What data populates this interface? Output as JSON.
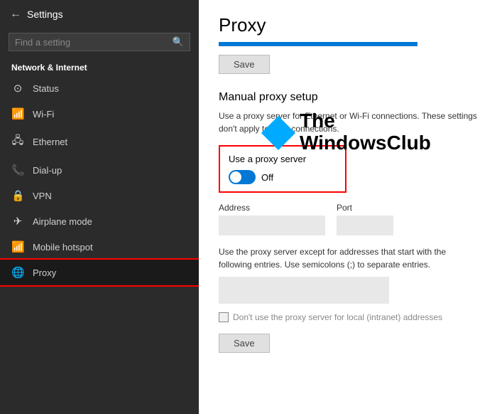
{
  "window": {
    "title": "Settings"
  },
  "sidebar": {
    "back_label": "←",
    "title": "Settings",
    "search_placeholder": "Find a setting",
    "section_label": "Network & Internet",
    "nav_items": [
      {
        "id": "status",
        "icon": "⊙",
        "label": "Status"
      },
      {
        "id": "wifi",
        "icon": "((•))",
        "label": "Wi-Fi"
      },
      {
        "id": "ethernet",
        "icon": "⬛",
        "label": "Ethernet"
      },
      {
        "id": "dialup",
        "icon": "📞",
        "label": "Dial-up"
      },
      {
        "id": "vpn",
        "icon": "🔒",
        "label": "VPN"
      },
      {
        "id": "airplane",
        "icon": "✈",
        "label": "Airplane mode"
      },
      {
        "id": "hotspot",
        "icon": "((·))",
        "label": "Mobile hotspot"
      },
      {
        "id": "proxy",
        "icon": "🌐",
        "label": "Proxy"
      }
    ]
  },
  "main": {
    "page_title": "Proxy",
    "save_top_label": "Save",
    "manual_section_title": "Manual proxy setup",
    "manual_section_desc": "Use a proxy server for Ethernet or Wi-Fi connections. These settings don't apply to VPN connections.",
    "proxy_server_label": "Use a proxy server",
    "toggle_state": "Off",
    "address_label": "Address",
    "port_label": "Port",
    "address_value": "",
    "port_value": "",
    "except_desc": "Use the proxy server except for addresses that start with the following entries. Use semicolons (;) to separate entries.",
    "exceptions_value": "",
    "checkbox_label": "Don't use the proxy server for local (intranet) addresses",
    "save_bottom_label": "Save"
  },
  "watermark": {
    "line1": "The",
    "line2": "WindowsClub"
  }
}
